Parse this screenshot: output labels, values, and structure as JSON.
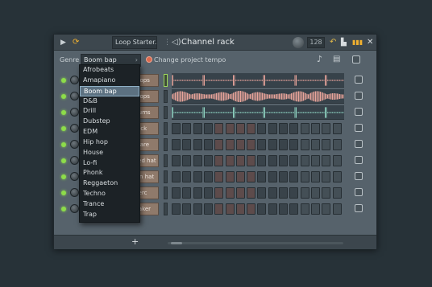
{
  "titlebar": {
    "pattern_selector": "Loop Starter...",
    "title": "Channel rack",
    "tempo": "128"
  },
  "toolbar": {
    "genre_label": "Genre",
    "genre_value": "Boom bap",
    "change_tempo_label": "Change project tempo"
  },
  "channels": [
    {
      "label": "Chops",
      "type": "wave"
    },
    {
      "label": "Chops",
      "type": "wave"
    },
    {
      "label": "Drums",
      "type": "wave"
    },
    {
      "label": "Kick",
      "type": "steps"
    },
    {
      "label": "Snare",
      "type": "steps"
    },
    {
      "label": "Closed hat",
      "type": "steps"
    },
    {
      "label": "Open hat",
      "type": "steps"
    },
    {
      "label": "Perc",
      "type": "steps"
    },
    {
      "label": "Shaker",
      "type": "steps"
    }
  ],
  "genre_options": [
    "Afrobeats",
    "Amapiano",
    "Boom bap",
    "D&B",
    "Drill",
    "Dubstep",
    "EDM",
    "Hip hop",
    "House",
    "Lo-fi",
    "Phonk",
    "Reggaeton",
    "Techno",
    "Trance",
    "Trap"
  ],
  "selected_genre_index": 2,
  "bottom": {
    "add_label": "+"
  },
  "colors": {
    "accent_green": "#8ddc4a",
    "channel_button": "#8f7a6b",
    "waveform": "#e8a49a"
  }
}
